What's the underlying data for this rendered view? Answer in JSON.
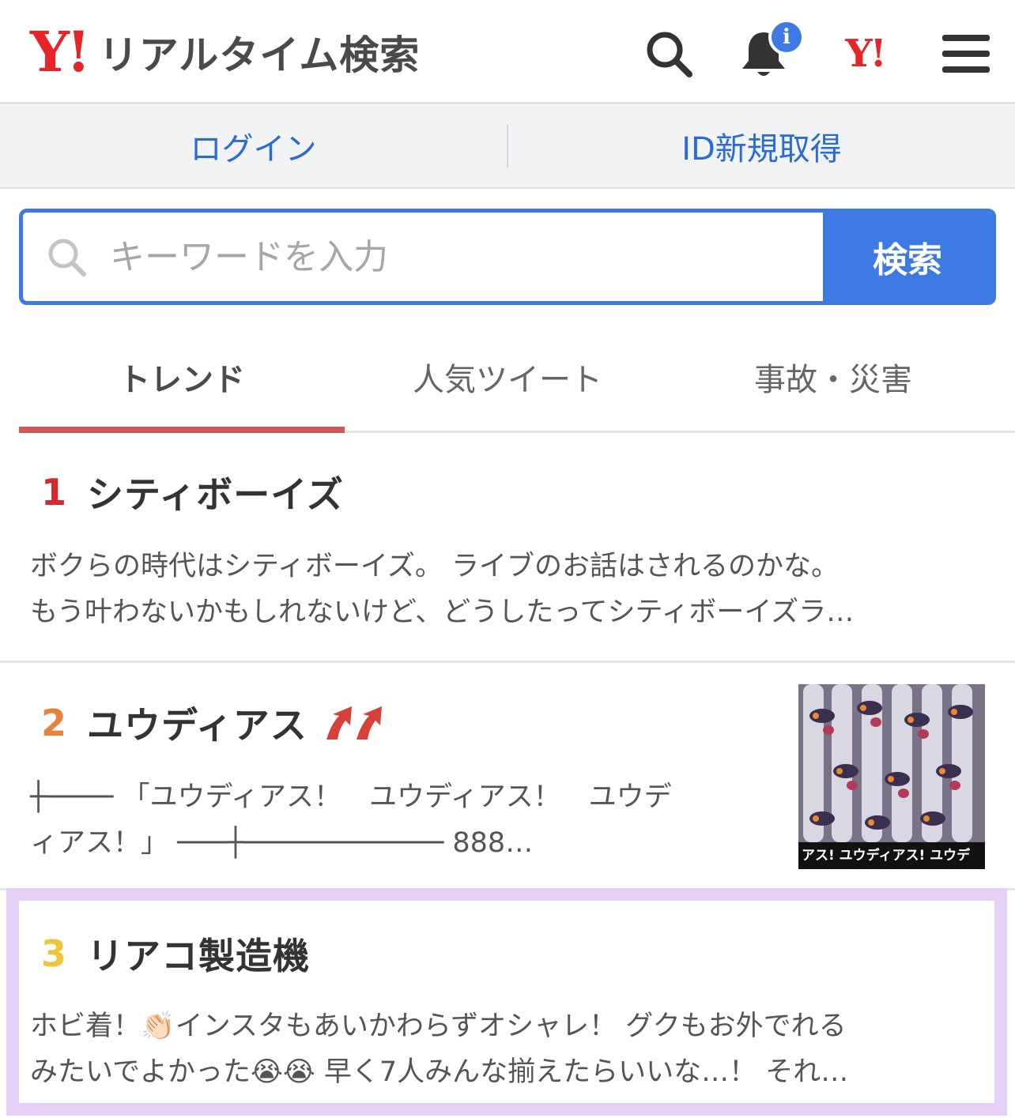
{
  "header": {
    "logo_mark": "Y!",
    "logo_text": "リアルタイム検索",
    "icons": [
      "search-icon",
      "bell-icon",
      "yahoo-logo-icon",
      "menu-icon"
    ],
    "badge": "i",
    "yahoo_mark": "Y!"
  },
  "account": {
    "login": "ログイン",
    "signup": "ID新規取得"
  },
  "search": {
    "placeholder": "キーワードを入力",
    "button": "検索"
  },
  "tabs": [
    {
      "label": "トレンド",
      "active": true
    },
    {
      "label": "人気ツイート",
      "active": false
    },
    {
      "label": "事故・災害",
      "active": false
    }
  ],
  "trends": [
    {
      "rank": "1",
      "title": "シティボーイズ",
      "desc_line1": "ボクらの時代はシティボーイズ。 ライブのお話はされるのかな。",
      "desc_line2": "もう叶わないかもしれないけど、どうしたってシティボーイズラ…",
      "rank_color": "#d8282e"
    },
    {
      "rank": "2",
      "title": "ユウディアス",
      "desc_line1": "┼──── 「ユウディアス！　ユウディアス！　ユウデ",
      "desc_line2": "ィアス！」 ───┼──────────── 888…",
      "thumb_caption": "アス! ユウディアス! ユウデ",
      "rank_color": "#e8823a"
    },
    {
      "rank": "3",
      "title": "リアコ製造機",
      "desc_line1": "ホビ着！👏🏻インスタもあいかわらずオシャレ！ グクもお外でれる",
      "desc_line2": "みたいでよかった😭😭 早く7人みんな揃えたらいいな…！ それ…",
      "rank_color": "#eec438"
    }
  ],
  "colors": {
    "brand_red": "#e8242b",
    "link_blue": "#2b6bd7",
    "search_blue": "#3d7ae3",
    "tab_underline": "#cf5a56",
    "highlight": "#e8d1f6"
  }
}
